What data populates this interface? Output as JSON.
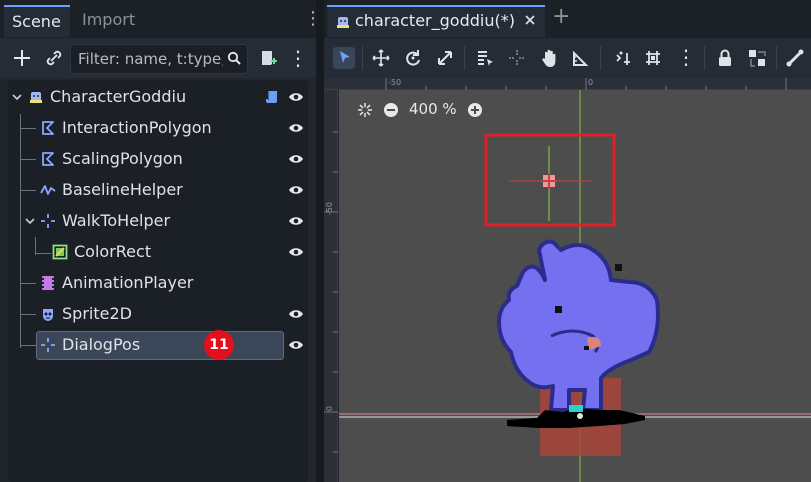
{
  "scene_dock": {
    "tabs": [
      "Scene",
      "Import"
    ],
    "filter_placeholder": "Filter: name, t:type, g:group",
    "nodes": [
      {
        "name": "CharacterGoddiu",
        "icon": "character-node-icon",
        "has_script": true,
        "visible_toggle": true
      },
      {
        "name": "InteractionPolygon",
        "icon": "polygon-node-icon",
        "visible_toggle": true
      },
      {
        "name": "ScalingPolygon",
        "icon": "polygon-node-icon",
        "visible_toggle": true
      },
      {
        "name": "BaselineHelper",
        "icon": "line-node-icon",
        "visible_toggle": true
      },
      {
        "name": "WalkToHelper",
        "icon": "marker-node-icon",
        "visible_toggle": true
      },
      {
        "name": "ColorRect",
        "icon": "color-rect-icon",
        "visible_toggle": true
      },
      {
        "name": "AnimationPlayer",
        "icon": "animation-player-icon",
        "visible_toggle": false
      },
      {
        "name": "Sprite2D",
        "icon": "sprite-icon",
        "visible_toggle": true
      },
      {
        "name": "DialogPos",
        "icon": "marker-node-icon",
        "visible_toggle": true,
        "selected": true
      }
    ],
    "badge": "11"
  },
  "editor": {
    "tab_title": "character_goddiu(*)",
    "zoom": "400 %",
    "ruler_top_labels": [
      "-50",
      "0"
    ],
    "ruler_left_labels": [
      "-50",
      "0"
    ]
  },
  "colors": {
    "accent": "#6aa0ff",
    "badge": "#e2101c",
    "highlight_box": "#e0202a",
    "character": "#7470f0"
  }
}
